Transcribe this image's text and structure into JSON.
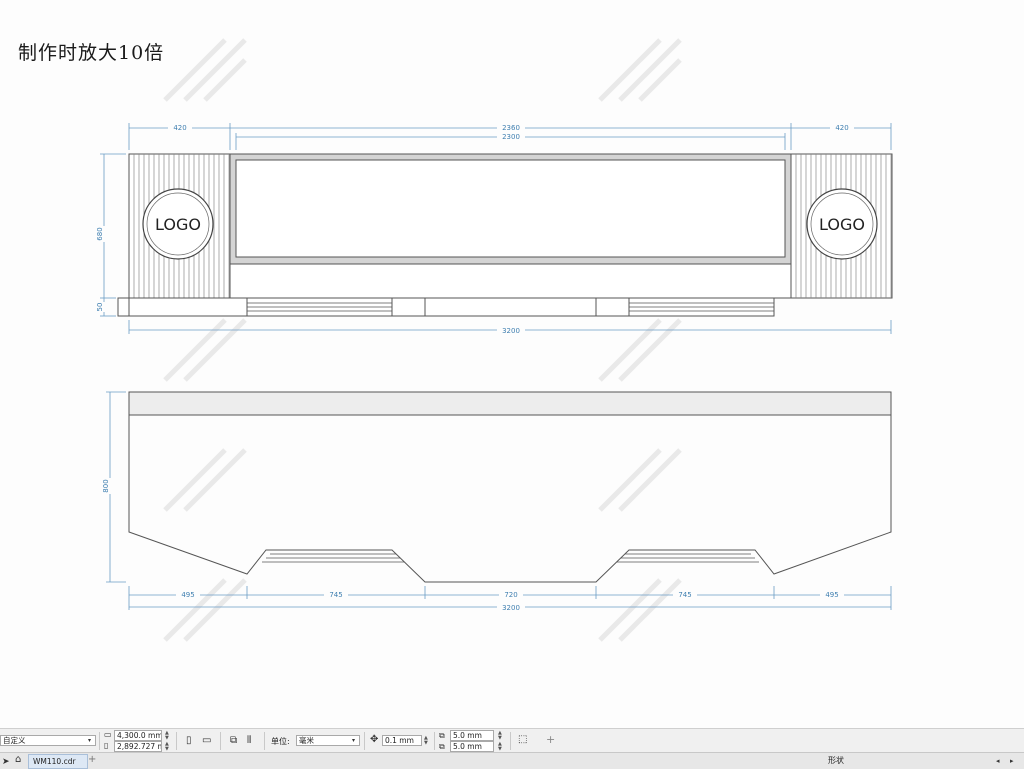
{
  "note": "制作时放大10倍",
  "front_view": {
    "logo_left": "LOGO",
    "logo_right": "LOGO",
    "dims": {
      "left_panel": "420",
      "center_outer": "2360",
      "center_inner": "2300",
      "right_panel": "420",
      "upper_height": "680",
      "base_height": "50",
      "total_width": "3200"
    }
  },
  "top_view": {
    "dims": {
      "depth": "800",
      "seg1": "495",
      "seg2": "745",
      "seg3": "720",
      "seg4": "745",
      "seg5": "495",
      "total_width": "3200"
    }
  },
  "toolbar": {
    "preset": "自定义",
    "width_value": "4,300.0 mm",
    "height_value": "2,892.727 mm",
    "units_label": "单位:",
    "units_value": "毫米",
    "nudge_value": "0.1 mm",
    "dup_x": "5.0 mm",
    "dup_y": "5.0 mm",
    "add_icon": "+"
  },
  "tabs": {
    "home_icon": "home-icon",
    "file_tab": "WM110.cdr",
    "add_tab": "+",
    "right_panel_label": "形状"
  }
}
